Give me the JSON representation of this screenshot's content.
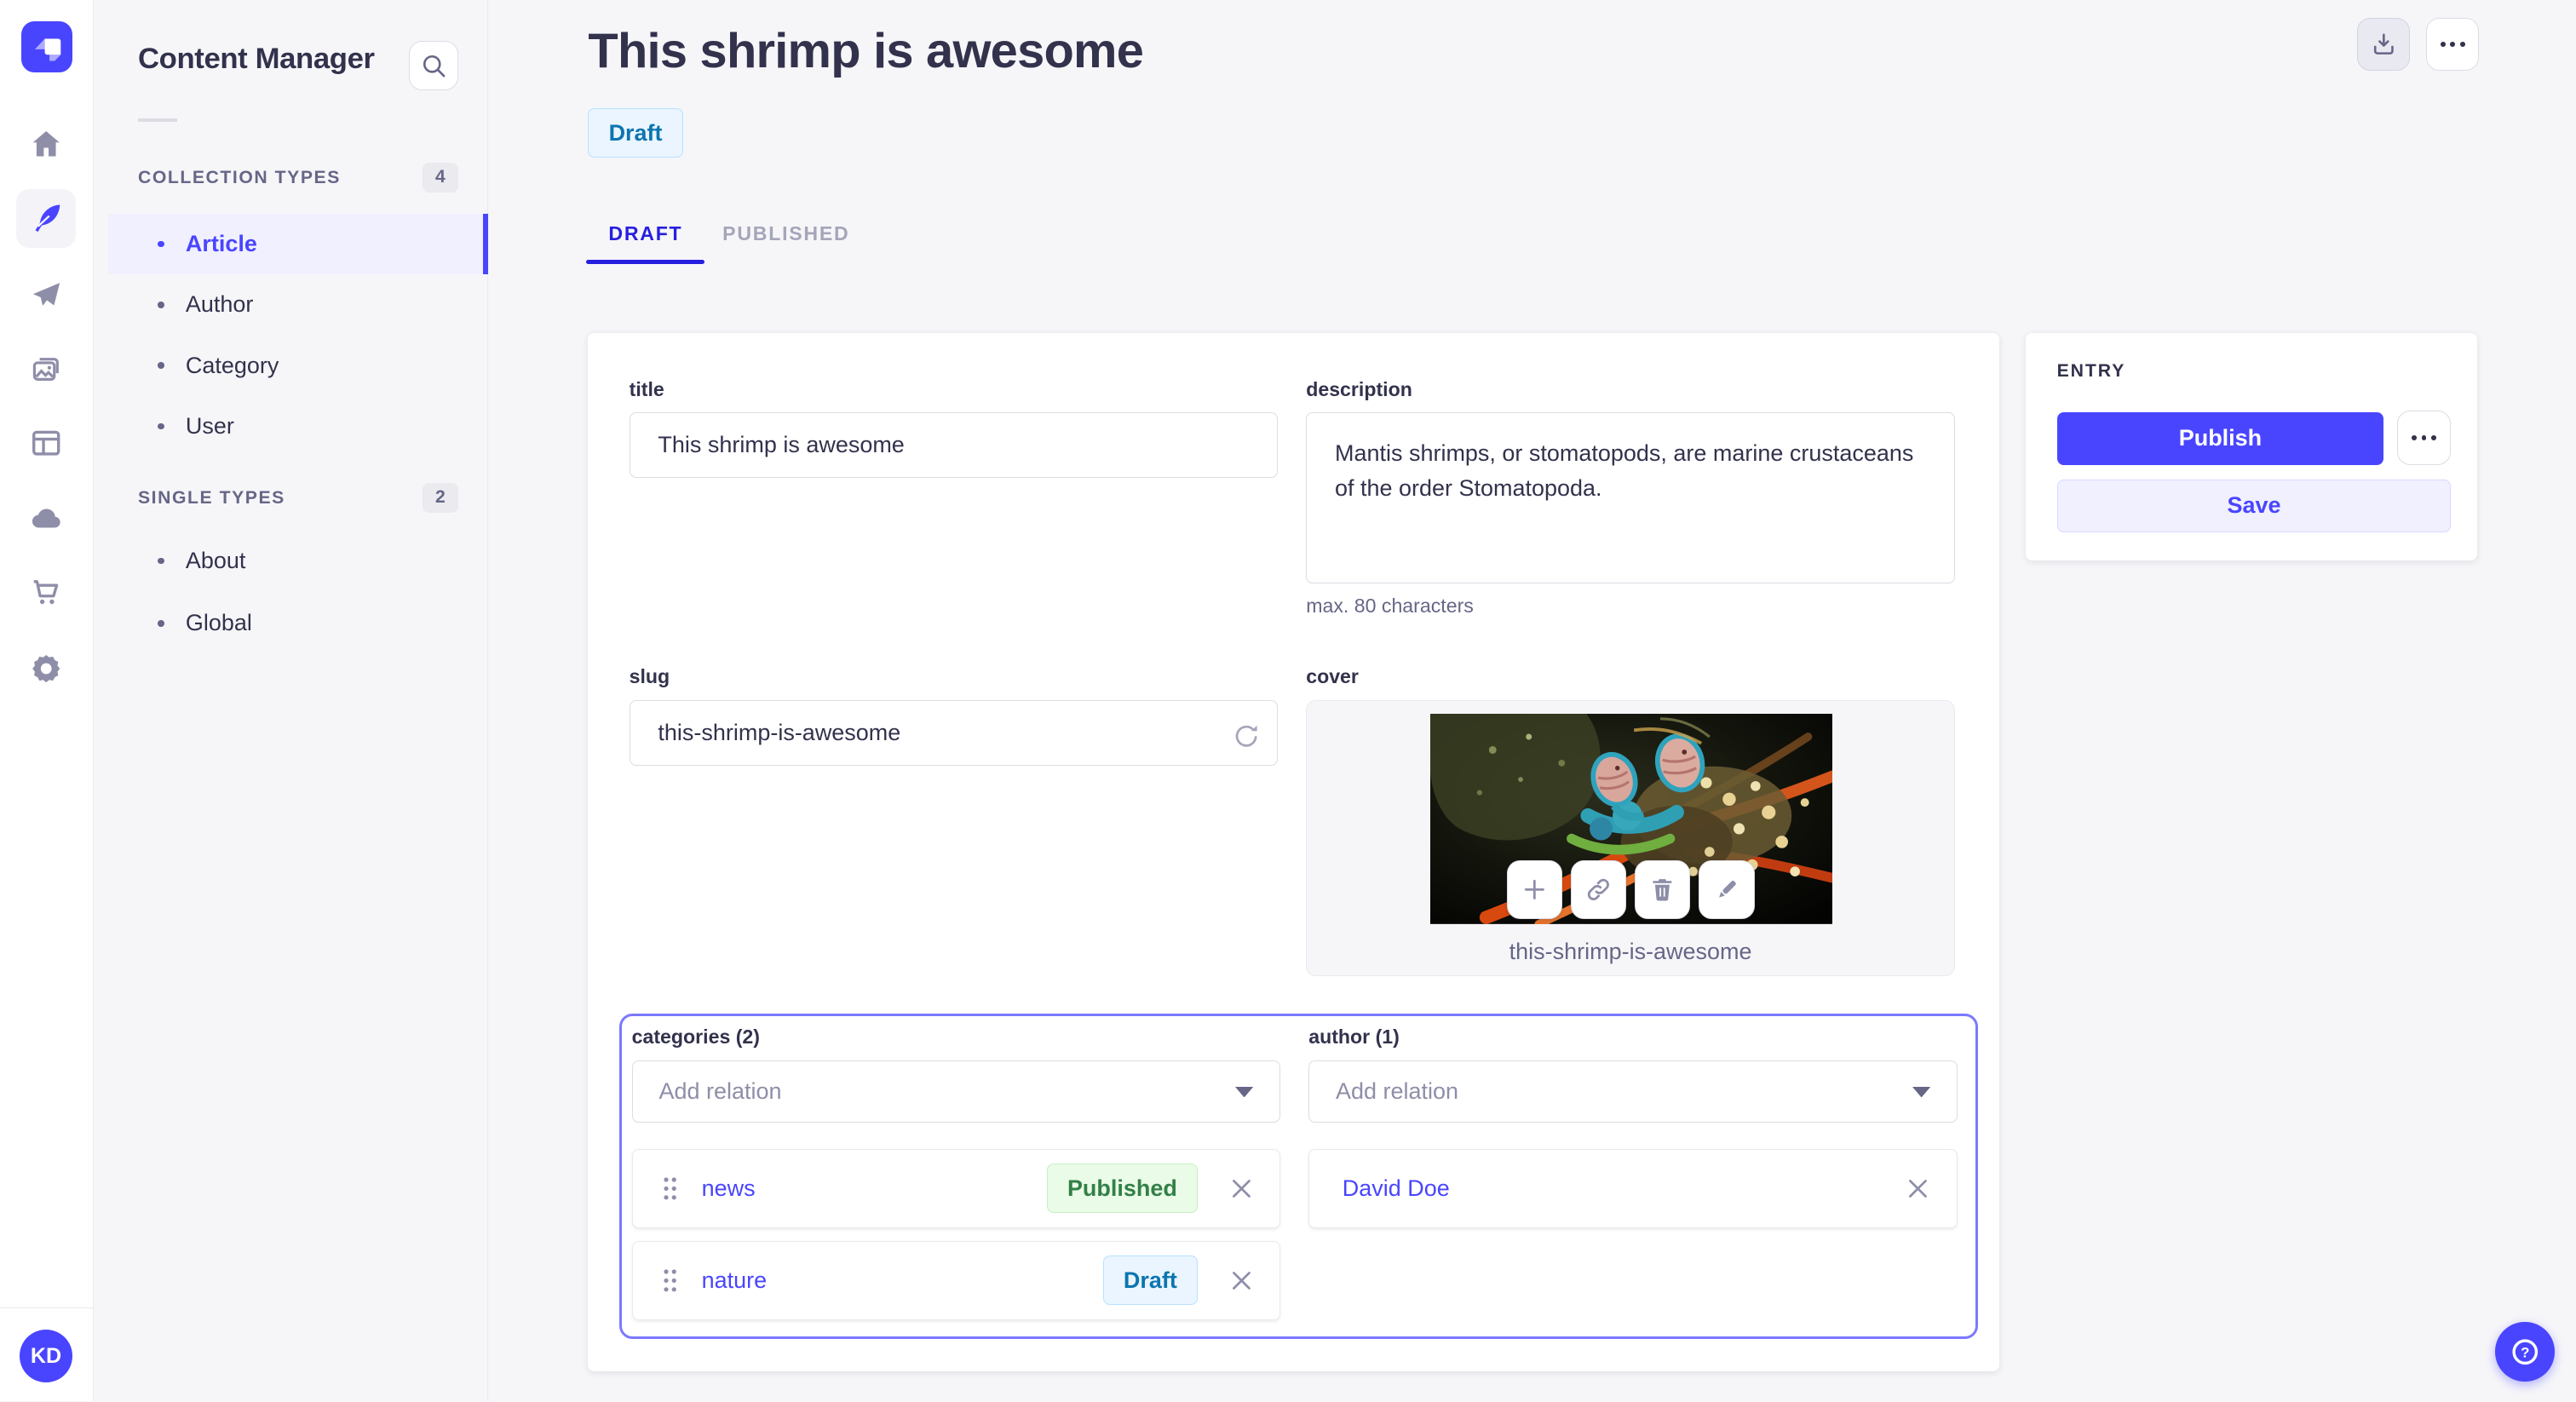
{
  "colors": {
    "primary": "#4945ff",
    "primary_dark": "#271fe0",
    "outline_purple": "#7b79ff",
    "page_bg": "#f6f6f9",
    "text_dark": "#32324d",
    "text_muted": "#666687",
    "published_badge_bg": "#eafbe7",
    "published_badge_text": "#328048",
    "draft_badge_bg": "#eaf5ff",
    "draft_badge_text": "#0c75af"
  },
  "icons": [
    "strapi-logo-icon",
    "home-icon",
    "content-feather-icon",
    "send-plane-icon",
    "media-library-icon",
    "layout-icon",
    "cloud-icon",
    "cart-icon",
    "settings-gear-icon",
    "search-icon",
    "download-icon",
    "ellipsis-icon",
    "refresh-icon",
    "chevron-down-icon",
    "plus-icon",
    "link-icon",
    "trash-icon",
    "pencil-icon",
    "close-x-icon",
    "drag-handle-icon",
    "help-question-icon"
  ],
  "primary_nav": {
    "avatar_initials": "KD"
  },
  "sidebar": {
    "title": "Content Manager",
    "sections": [
      {
        "label": "COLLECTION TYPES",
        "count": "4",
        "items": [
          {
            "label": "Article"
          },
          {
            "label": "Author"
          },
          {
            "label": "Category"
          },
          {
            "label": "User"
          }
        ]
      },
      {
        "label": "SINGLE TYPES",
        "count": "2",
        "items": [
          {
            "label": "About"
          },
          {
            "label": "Global"
          }
        ]
      }
    ]
  },
  "header": {
    "title": "This shrimp is awesome",
    "status": "Draft",
    "tabs": [
      {
        "label": "DRAFT"
      },
      {
        "label": "PUBLISHED"
      }
    ]
  },
  "form": {
    "title": {
      "label": "title",
      "value": "This shrimp is awesome"
    },
    "description": {
      "label": "description",
      "value": "Mantis shrimps, or stomatopods, are marine crustaceans of the order Stomatopoda.",
      "hint": "max. 80 characters"
    },
    "slug": {
      "label": "slug",
      "value": "this-shrimp-is-awesome"
    },
    "cover": {
      "label": "cover",
      "caption": "this-shrimp-is-awesome"
    },
    "categories": {
      "label": "categories (2)",
      "placeholder": "Add relation",
      "items": [
        {
          "name": "news",
          "status": "Published"
        },
        {
          "name": "nature",
          "status": "Draft"
        }
      ]
    },
    "author": {
      "label": "author (1)",
      "placeholder": "Add relation",
      "items": [
        {
          "name": "David Doe"
        }
      ]
    }
  },
  "entry_panel": {
    "title": "ENTRY",
    "publish_label": "Publish",
    "save_label": "Save"
  }
}
